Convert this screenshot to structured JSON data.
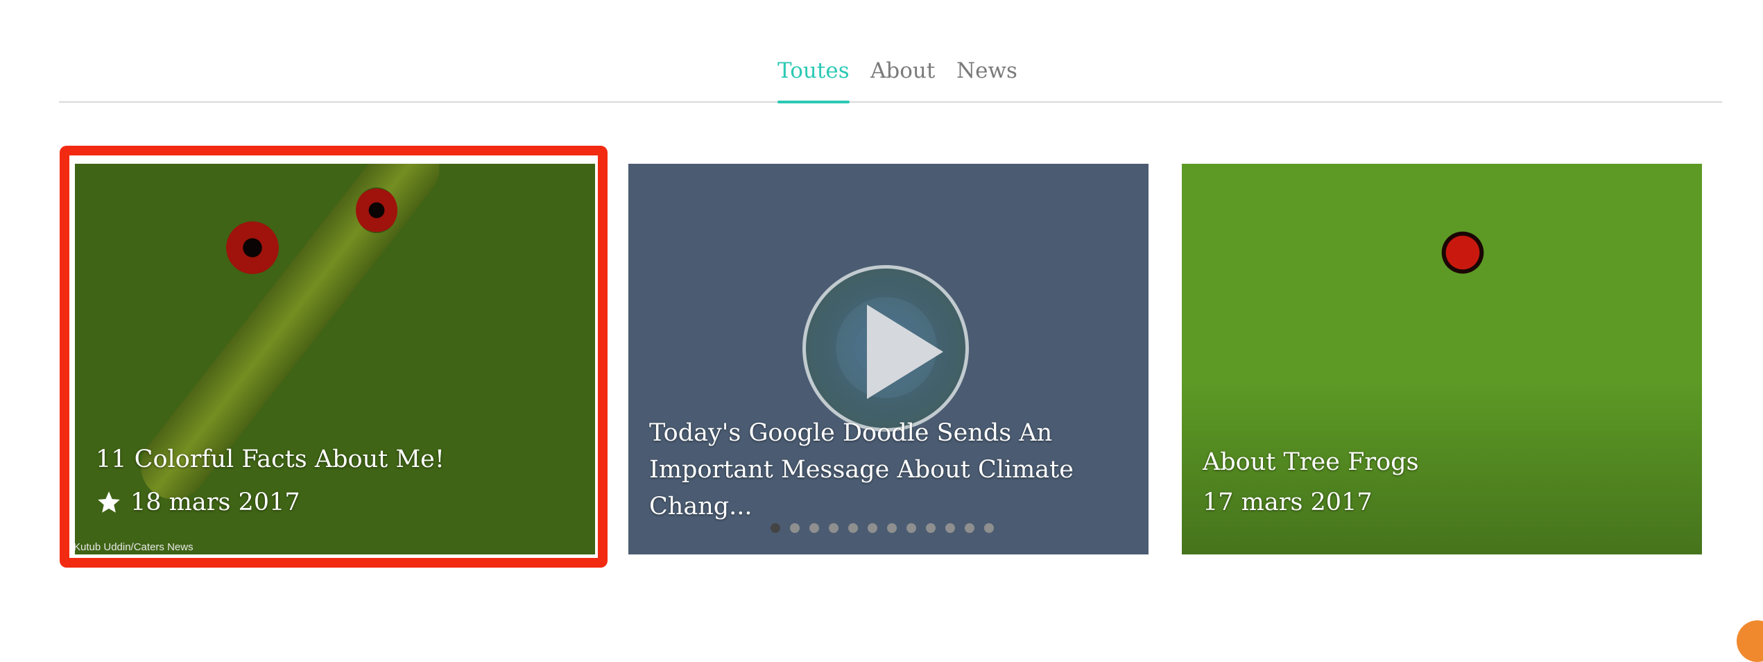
{
  "tabs": [
    {
      "label": "Toutes",
      "active": true
    },
    {
      "label": "About",
      "active": false
    },
    {
      "label": "News",
      "active": false
    }
  ],
  "cards": [
    {
      "title": "11 Colorful Facts About Me!",
      "date": "18 mars 2017",
      "starred": true,
      "image_credit": "Kutub Uddin/Caters News",
      "selected": true
    },
    {
      "title": "Today's Google Doodle Sends An Important Message About Climate Chang...",
      "type": "video",
      "carousel_dots": 12,
      "carousel_active_index": 0
    },
    {
      "title": "About Tree Frogs",
      "date": "17 mars 2017"
    }
  ],
  "colors": {
    "accent": "#2bc9b4",
    "tab_inactive": "#7a7a7a",
    "selection": "#f22a12",
    "corner_badge": "#f0892e"
  }
}
